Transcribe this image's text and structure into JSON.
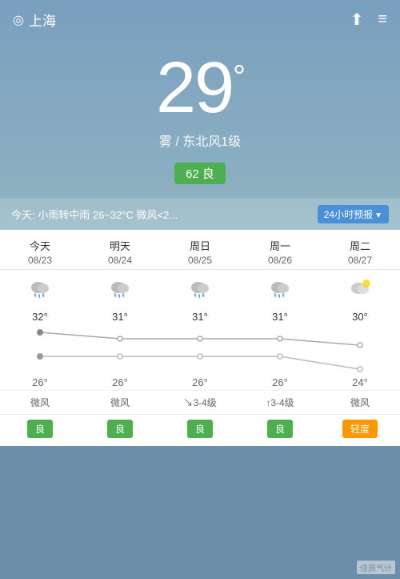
{
  "header": {
    "location": "上海",
    "share_icon": "⬆",
    "menu_icon": "≡"
  },
  "current": {
    "temperature": "29",
    "degree_symbol": "°",
    "weather_desc": "雾 / 东北风1级",
    "aqi_value": "62",
    "aqi_label": "良",
    "today_notice": "今天: 小雨转中雨  26~32°C  微风<2...",
    "forecast_btn_label": "24小时预报",
    "forecast_arrow": "▼"
  },
  "forecast": {
    "days": [
      {
        "name": "今天",
        "date": "08/23",
        "icon": "🌧",
        "high": "32°",
        "low": "26°",
        "wind": "微风",
        "aqi": "良",
        "aqi_type": "good"
      },
      {
        "name": "明天",
        "date": "08/24",
        "icon": "🌧",
        "high": "31°",
        "low": "26°",
        "wind": "微风",
        "aqi": "良",
        "aqi_type": "good"
      },
      {
        "name": "周日",
        "date": "08/25",
        "icon": "🌧",
        "high": "31°",
        "low": "26°",
        "wind": "↘3-4级",
        "aqi": "良",
        "aqi_type": "good"
      },
      {
        "name": "周一",
        "date": "08/26",
        "icon": "🌧",
        "high": "31°",
        "low": "26°",
        "wind": "↑3-4级",
        "aqi": "良",
        "aqi_type": "good"
      },
      {
        "name": "周二",
        "date": "08/27",
        "icon": "🌦",
        "high": "30°",
        "low": "24°",
        "wind": "微风",
        "aqi": "轻度",
        "aqi_type": "moderate"
      }
    ],
    "high_values": [
      32,
      31,
      31,
      31,
      30
    ],
    "low_values": [
      26,
      26,
      26,
      26,
      24
    ]
  },
  "watermark": "佳辰气计"
}
